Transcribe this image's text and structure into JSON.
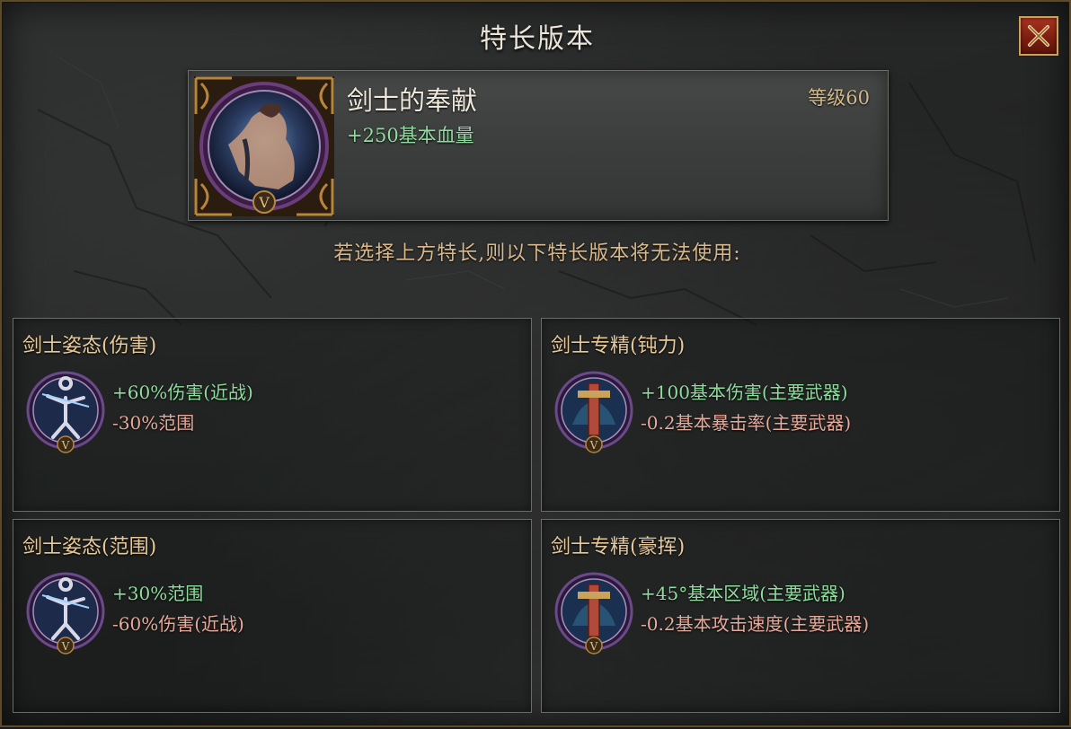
{
  "window": {
    "title": "特长版本",
    "close_icon": "close-x-icon"
  },
  "featured": {
    "name": "剑士的奉献",
    "level": "等级60",
    "bonus": "+250基本血量",
    "portrait_icon": "swordsman-portrait-icon",
    "rank_badge": "V"
  },
  "notice": "若选择上方特长,则以下特长版本将无法使用:",
  "variants": [
    {
      "title": "剑士姿态(伤害)",
      "icon": "swordsman-stance-icon",
      "badge": "V",
      "line1": "+60%伤害(近战)",
      "line2": "-30%范围"
    },
    {
      "title": "剑士专精(钝力)",
      "icon": "swordsman-mastery-icon",
      "badge": "V",
      "line1": "+100基本伤害(主要武器)",
      "line2": "-0.2基本暴击率(主要武器)"
    },
    {
      "title": "剑士姿态(范围)",
      "icon": "swordsman-stance-icon",
      "badge": "V",
      "line1": "+30%范围",
      "line2": "-60%伤害(近战)"
    },
    {
      "title": "剑士专精(豪挥)",
      "icon": "swordsman-mastery-icon",
      "badge": "V",
      "line1": "+45°基本区域(主要武器)",
      "line2": "-0.2基本攻击速度(主要武器)"
    }
  ],
  "colors": {
    "positive": "#8fdc9e",
    "negative": "#e7a99a",
    "title_gold": "#e7c89a",
    "frame_gold": "#c9a25c",
    "close_red": "#a8331f"
  }
}
